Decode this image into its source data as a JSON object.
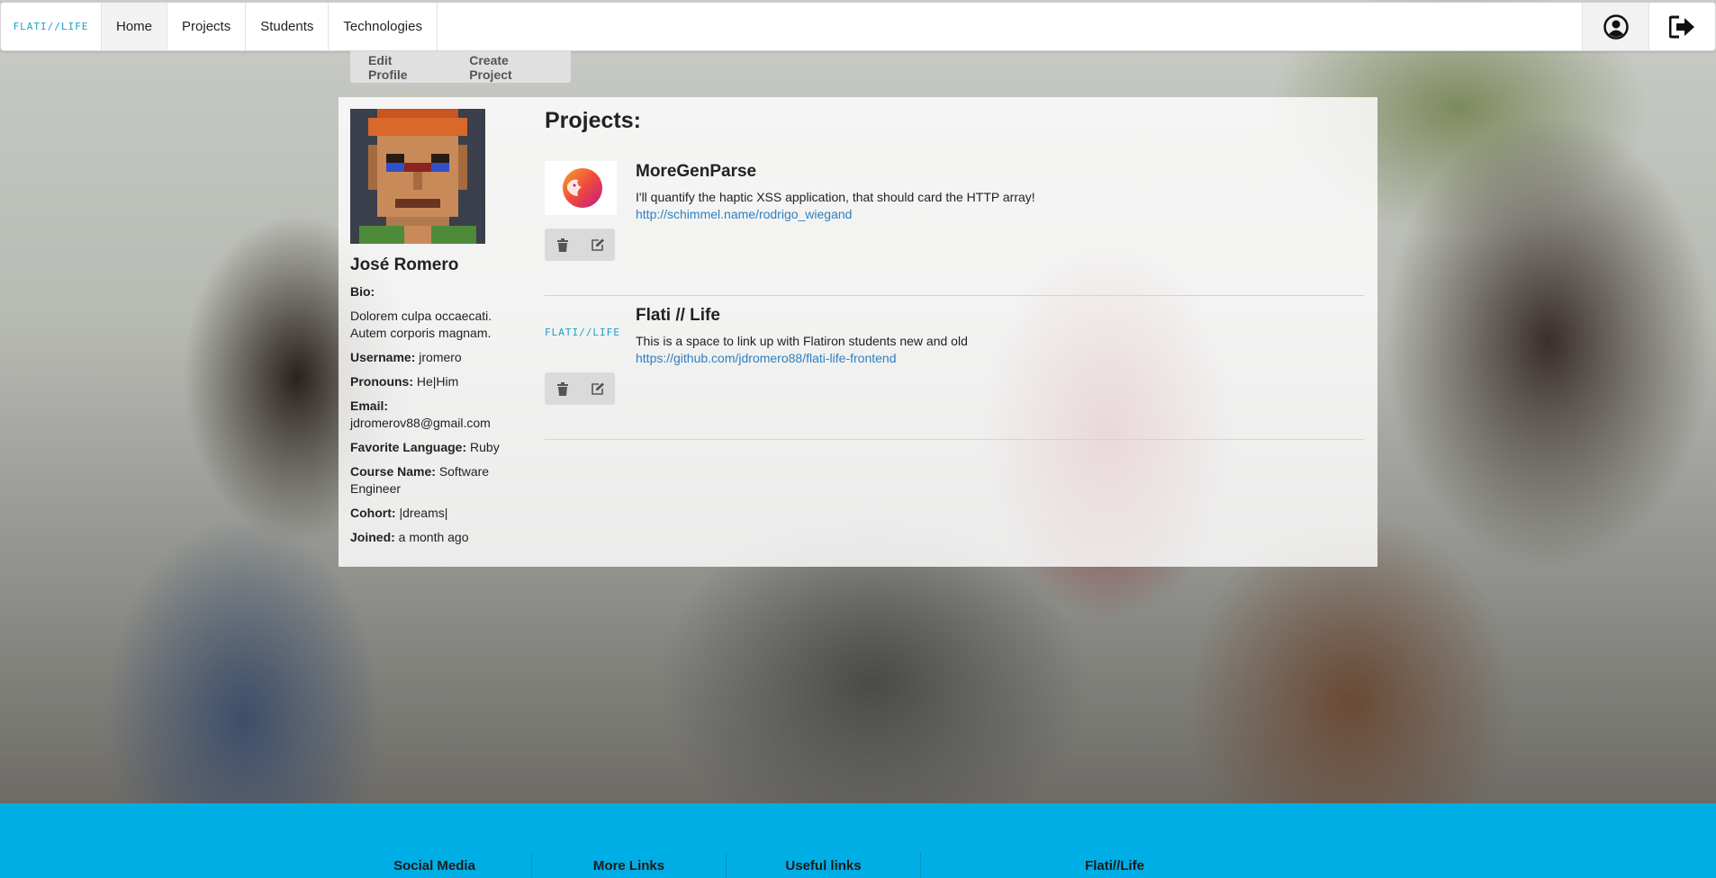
{
  "nav": {
    "logo": "FLATI//LIFE",
    "items": [
      {
        "label": "Home"
      },
      {
        "label": "Projects"
      },
      {
        "label": "Students"
      },
      {
        "label": "Technologies"
      }
    ],
    "icons": [
      "user-circle-icon",
      "sign-out-icon"
    ]
  },
  "submenu": {
    "edit_profile": "Edit Profile",
    "create_project": "Create Project"
  },
  "profile": {
    "name": "José Romero",
    "bio_label": "Bio:",
    "bio": "Dolorem culpa occaecati. Autem corporis magnam.",
    "username_label": "Username:",
    "username": "jromero",
    "pronouns_label": "Pronouns:",
    "pronouns": "He|Him",
    "email_label": "Email:",
    "email": "jdromerov88@gmail.com",
    "language_label": "Favorite Language:",
    "language": "Ruby",
    "course_label": "Course Name:",
    "course": "Software Engineer",
    "cohort_label": "Cohort:",
    "cohort": "|dreams|",
    "joined_label": "Joined:",
    "joined": "a month ago"
  },
  "projects": {
    "title": "Projects:",
    "items": [
      {
        "name": "MoreGenParse",
        "description": "I'll quantify the haptic XSS application, that should card the HTTP array!",
        "link": "http://schimmel.name/rodrigo_wiegand",
        "thumb_logo": ""
      },
      {
        "name": "Flati // Life",
        "description": "This is a space to link up with Flatiron students new and old",
        "link": "https://github.com/jdromero88/flati-life-frontend",
        "thumb_logo": "FLATI//LIFE"
      }
    ]
  },
  "footer": {
    "columns": [
      "Social Media",
      "More Links",
      "Useful links",
      "Flati//Life"
    ]
  },
  "colors": {
    "accent": "#00aee6",
    "link": "#2f7ec2",
    "logo": "#1b9fc8"
  }
}
